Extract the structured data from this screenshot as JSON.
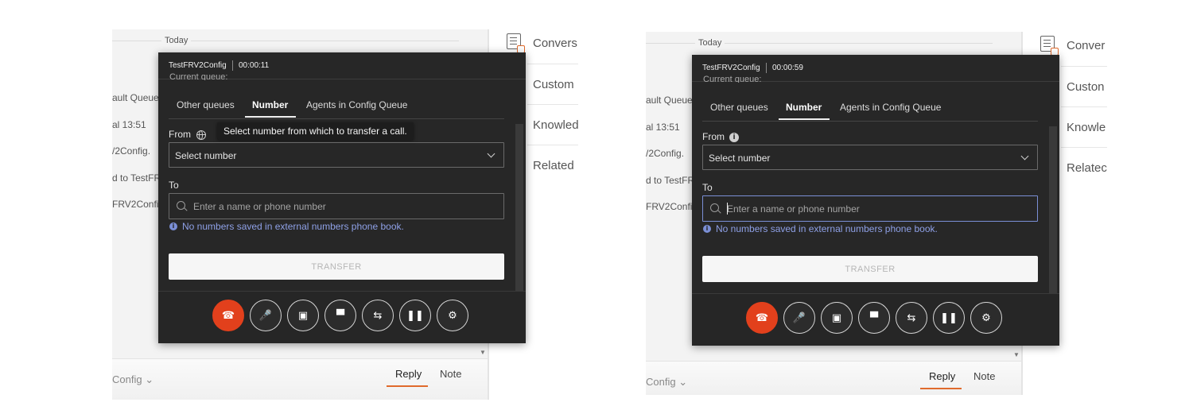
{
  "shots": [
    {
      "chat": {
        "today_label": "Today",
        "lines": [
          "ault Queue",
          "al  13:51",
          "/2Config.",
          "d to TestFR",
          "FRV2Confi"
        ]
      },
      "right_panel": {
        "items": [
          "Convers",
          "Custom",
          "Knowled",
          "Related"
        ]
      },
      "footer": {
        "left_label": "Config  ⌄",
        "reply_label": "Reply",
        "note_label": "Note"
      },
      "dialog": {
        "title": "TestFRV2Config",
        "timer": "00:00:11",
        "cut_text": "Current queue:",
        "tabs": [
          "Other queues",
          "Number",
          "Agents in Config Queue"
        ],
        "active_tab": 1,
        "from_label": "From",
        "tooltip": "Select number from which to transfer a call.",
        "select_value": "Select number",
        "to_label": "To",
        "search_placeholder": "Enter a name or phone number",
        "hint": "No numbers saved in external numbers phone book.",
        "transfer_label": "TRANSFER"
      }
    },
    {
      "chat": {
        "today_label": "Today",
        "lines": [
          "ault Queue",
          "al  13:51",
          "/2Config.",
          "d to TestFR",
          "FRV2Confi"
        ]
      },
      "right_panel": {
        "items": [
          "Conver",
          "Custon",
          "Knowle",
          "Relatec"
        ]
      },
      "footer": {
        "left_label": "Config  ⌄",
        "reply_label": "Reply",
        "note_label": "Note"
      },
      "dialog": {
        "title": "TestFRV2Config",
        "timer": "00:00:59",
        "cut_text": "Current queue:",
        "tabs": [
          "Other queues",
          "Number",
          "Agents in Config Queue"
        ],
        "active_tab": 1,
        "from_label": "From",
        "select_value": "Select number",
        "to_label": "To",
        "search_placeholder": "Enter a name or phone number",
        "hint": "No numbers saved in external numbers phone book.",
        "transfer_label": "TRANSFER"
      }
    }
  ],
  "control_icons": [
    "hangup-icon",
    "mute-icon",
    "video-off-icon",
    "screen-share-icon",
    "transfer-icon",
    "hold-icon",
    "settings-icon"
  ],
  "colors": {
    "hangup": "#e2401c",
    "accent": "#e06a2c",
    "hint": "#8ea0e6",
    "dialog_bg": "#272727"
  }
}
